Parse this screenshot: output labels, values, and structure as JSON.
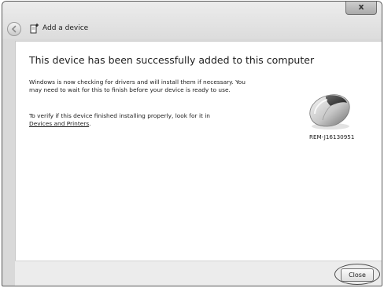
{
  "window": {
    "close_glyph": "x",
    "title": "Add a device"
  },
  "content": {
    "heading": "This device has been successfully added to this computer",
    "paragraph1": "Windows is now checking for drivers and will install them if necessary. You may need to wait for this to finish before your device is ready to use.",
    "paragraph2_prefix": "To verify if this device finished installing properly, look for it in",
    "paragraph2_link": "Devices and Printers",
    "paragraph2_suffix": ".",
    "device_name": "REM-J16130951",
    "device_icon": "wireless-mouse-icon"
  },
  "footer": {
    "close_label": "Close"
  }
}
